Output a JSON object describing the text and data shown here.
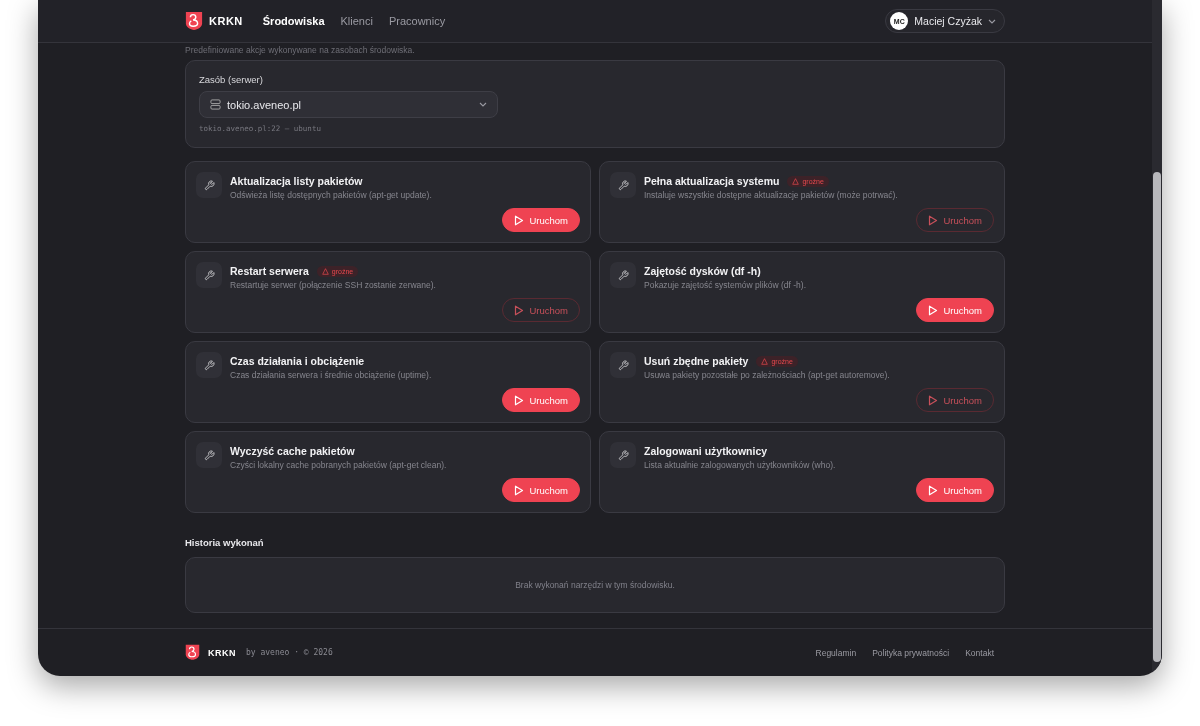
{
  "header": {
    "brand": "KRKN",
    "nav": [
      {
        "label": "Środowiska",
        "selected": true
      },
      {
        "label": "Klienci",
        "selected": false
      },
      {
        "label": "Pracownicy",
        "selected": false
      }
    ],
    "user": {
      "initials": "MC",
      "name": "Maciej Czyżak"
    }
  },
  "subtitle": "Predefiniowane akcje wykonywane na zasobach środowiska.",
  "resource": {
    "label": "Zasób (serwer)",
    "value": "tokio.aveneo.pl",
    "hint": "tokio.aveneo.pl:22 — ubuntu"
  },
  "tools": [
    {
      "title": "Aktualizacja listy pakietów",
      "description": "Odświeża listę dostępnych pakietów (apt-get update).",
      "dangerous": false,
      "button": "Uruchom"
    },
    {
      "title": "Pełna aktualizacja systemu",
      "badge": "groźne",
      "description": "Instaluje wszystkie dostępne aktualizacje pakietów (może potrwać).",
      "dangerous": true,
      "button": "Uruchom"
    },
    {
      "title": "Restart serwera",
      "badge": "groźne",
      "description": "Restartuje serwer (połączenie SSH zostanie zerwane).",
      "dangerous": true,
      "button": "Uruchom"
    },
    {
      "title": "Zajętość dysków (df -h)",
      "description": "Pokazuje zajętość systemów plików (df -h).",
      "dangerous": false,
      "button": "Uruchom"
    },
    {
      "title": "Czas działania i obciążenie",
      "description": "Czas działania serwera i średnie obciążenie (uptime).",
      "dangerous": false,
      "button": "Uruchom"
    },
    {
      "title": "Usuń zbędne pakiety",
      "badge": "groźne",
      "description": "Usuwa pakiety pozostałe po zależnościach (apt-get autoremove).",
      "dangerous": true,
      "button": "Uruchom"
    },
    {
      "title": "Wyczyść cache pakietów",
      "description": "Czyści lokalny cache pobranych pakietów (apt-get clean).",
      "dangerous": false,
      "button": "Uruchom"
    },
    {
      "title": "Zalogowani użytkownicy",
      "description": "Lista aktualnie zalogowanych użytkowników (who).",
      "dangerous": false,
      "button": "Uruchom"
    }
  ],
  "history": {
    "title": "Historia wykonań",
    "empty": "Brak wykonań narzędzi w tym środowisku."
  },
  "footer": {
    "brand": "KRKN",
    "credit": "by aveneo · © 2026",
    "links": [
      "Regulamin",
      "Polityka prywatności",
      "Kontakt"
    ]
  }
}
